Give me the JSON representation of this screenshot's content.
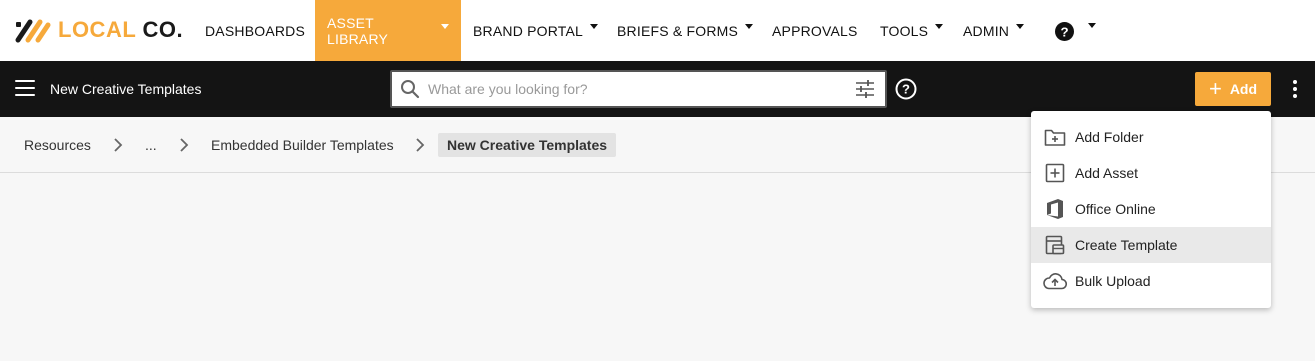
{
  "brand": {
    "logo_local": "LOCAL",
    "logo_co": " CO."
  },
  "nav": {
    "items": [
      {
        "label": "DASHBOARDS",
        "has_caret": false,
        "active": false
      },
      {
        "label": "ASSET LIBRARY",
        "has_caret": true,
        "active": true
      },
      {
        "label": "BRAND PORTAL",
        "has_caret": true,
        "active": false
      },
      {
        "label": "BRIEFS & FORMS",
        "has_caret": true,
        "active": false
      },
      {
        "label": "APPROVALS",
        "has_caret": false,
        "active": false
      },
      {
        "label": "TOOLS",
        "has_caret": true,
        "active": false
      },
      {
        "label": "ADMIN",
        "has_caret": true,
        "active": false
      }
    ],
    "help_icon": "question-circle-icon"
  },
  "toolbar": {
    "title": "New Creative Templates",
    "search_placeholder": "What are you looking for?",
    "add_label": "Add"
  },
  "breadcrumb": {
    "items": [
      "Resources",
      "...",
      "Embedded Builder Templates"
    ],
    "current": "New Creative Templates"
  },
  "dropdown": {
    "items": [
      {
        "label": "Add Folder",
        "icon": "folder-plus-icon"
      },
      {
        "label": "Add Asset",
        "icon": "square-plus-icon"
      },
      {
        "label": "Office Online",
        "icon": "office-icon"
      },
      {
        "label": "Create Template",
        "icon": "template-icon",
        "highlighted": true
      },
      {
        "label": "Bulk Upload",
        "icon": "cloud-upload-icon"
      }
    ]
  },
  "colors": {
    "accent": "#f6a93b",
    "toolbar_bg": "#141414",
    "page_bg": "#f7f7f7"
  }
}
